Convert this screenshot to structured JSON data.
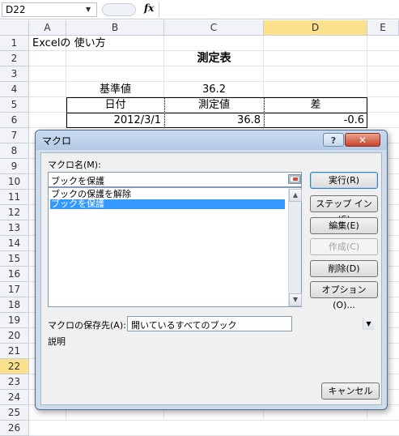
{
  "formula_bar": {
    "name_box": "D22",
    "fx_label": "fx",
    "formula": ""
  },
  "columns": [
    "A",
    "B",
    "C",
    "D",
    "E"
  ],
  "rows": [
    "1",
    "2",
    "3",
    "4",
    "5",
    "6",
    "7",
    "8",
    "9",
    "10",
    "11",
    "12",
    "13",
    "14",
    "15",
    "16",
    "17",
    "18",
    "19",
    "20",
    "21",
    "22",
    "23",
    "24",
    "25",
    "26"
  ],
  "cells": {
    "a1": "Excelの 使い方",
    "title": "測定表",
    "baseline_label": "基準値",
    "baseline_value": "36.2",
    "hdr_date": "日付",
    "hdr_value": "測定値",
    "hdr_diff": "差",
    "r6_date": "2012/3/1",
    "r6_value": "36.8",
    "r6_diff": "-0.6"
  },
  "dialog": {
    "title": "マクロ",
    "help": "?",
    "close": "✕",
    "macro_name_label": "マクロ名(M):",
    "macro_name_value": "ブックを保護",
    "macros": [
      "ブックの保護を解除",
      "ブックを保護"
    ],
    "selected_index": 1,
    "buttons": {
      "run": "実行(R)",
      "step_into": "ステップ イン(S)",
      "edit": "編集(E)",
      "create": "作成(C)",
      "delete": "削除(D)",
      "options": "オプション(O)...",
      "cancel": "キャンセル"
    },
    "store_label": "マクロの保存先(A):",
    "store_value": "開いているすべてのブック",
    "description_label": "説明"
  },
  "colors": {
    "selection_header": "#fbe18c",
    "list_selection": "#3399ff",
    "dialog_frame": "#cfdceb"
  }
}
